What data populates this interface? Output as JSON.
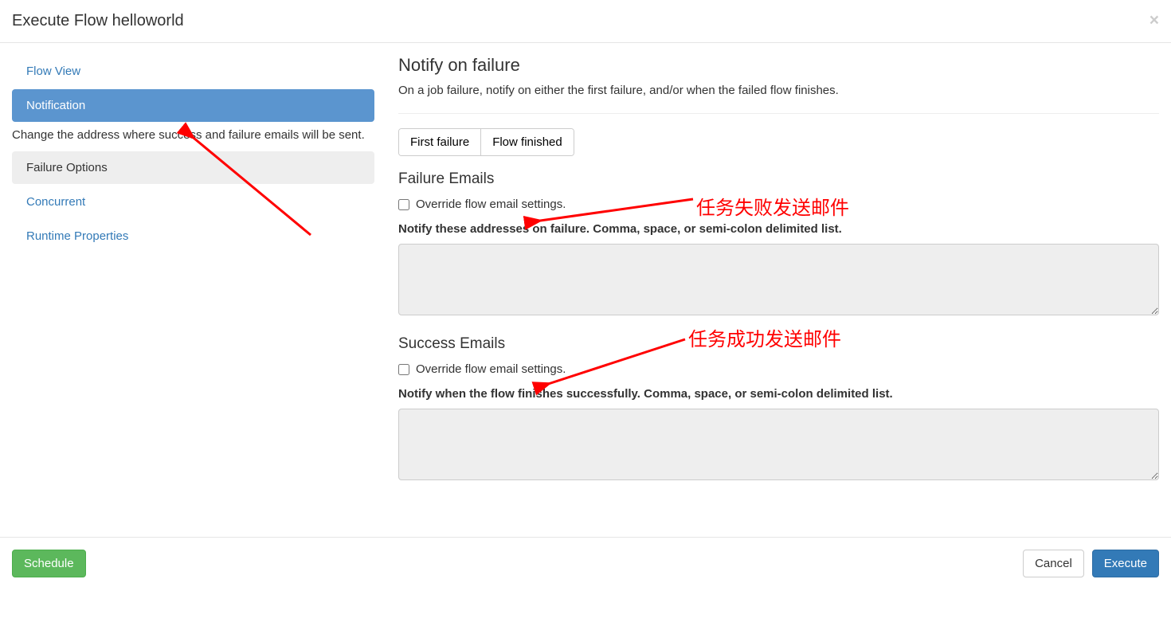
{
  "header": {
    "title": "Execute Flow helloworld",
    "close_glyph": "×"
  },
  "sidebar": {
    "items": [
      {
        "label": "Flow View"
      },
      {
        "label": "Notification"
      },
      {
        "label": "Failure Options"
      },
      {
        "label": "Concurrent"
      },
      {
        "label": "Runtime Properties"
      }
    ],
    "notification_desc": "Change the address where success and failure emails will be sent."
  },
  "main": {
    "notify_title": "Notify on failure",
    "notify_desc": "On a job failure, notify on either the first failure, and/or when the failed flow finishes.",
    "toggle": {
      "first_failure": "First failure",
      "flow_finished": "Flow finished"
    },
    "failure_heading": "Failure Emails",
    "failure_override_label": "Override flow email settings.",
    "failure_list_label": "Notify these addresses on failure. Comma, space, or semi-colon delimited list.",
    "failure_value": "",
    "success_heading": "Success Emails",
    "success_override_label": "Override flow email settings.",
    "success_list_label": "Notify when the flow finishes successfully. Comma, space, or semi-colon delimited list.",
    "success_value": ""
  },
  "footer": {
    "schedule": "Schedule",
    "cancel": "Cancel",
    "execute": "Execute"
  },
  "annotations": {
    "fail_text": "任务失败发送邮件",
    "success_text": "任务成功发送邮件"
  }
}
